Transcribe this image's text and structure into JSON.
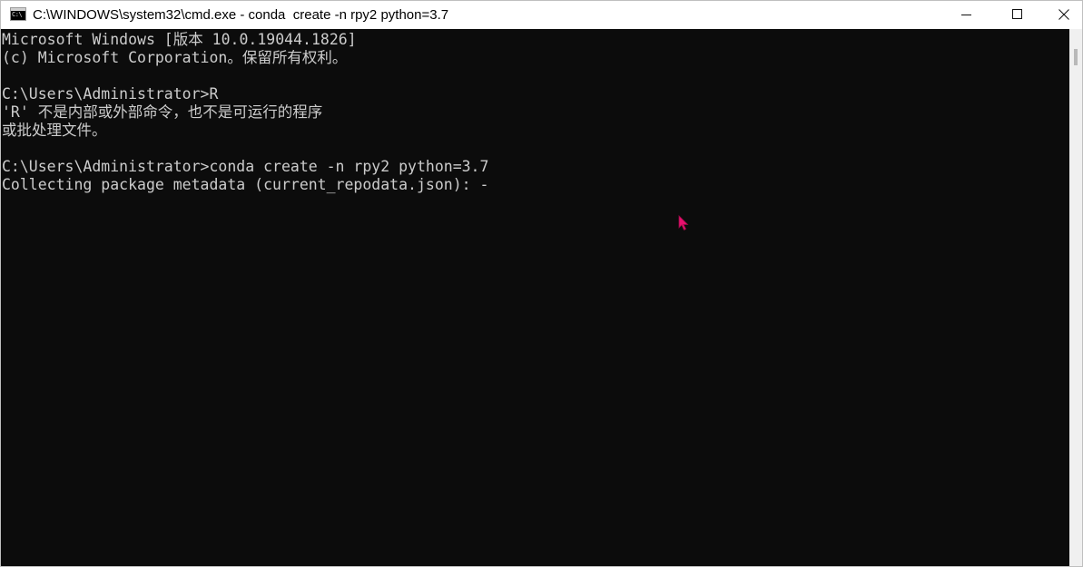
{
  "window": {
    "title": "C:\\WINDOWS\\system32\\cmd.exe - conda  create -n rpy2 python=3.7",
    "app_icon_text": "C:\\"
  },
  "console": {
    "lines": [
      "Microsoft Windows [版本 10.0.19044.1826]",
      "(c) Microsoft Corporation。保留所有权利。",
      "",
      "C:\\Users\\Administrator>R",
      "'R' 不是内部或外部命令，也不是可运行的程序",
      "或批处理文件。",
      "",
      "C:\\Users\\Administrator>conda create -n rpy2 python=3.7",
      "Collecting package metadata (current_repodata.json): -"
    ]
  },
  "colors": {
    "console_background": "#0c0c0c",
    "console_text": "#cccccc",
    "cursor_accent": "#e8106e"
  },
  "icons": {
    "app": "cmd-icon",
    "minimize": "minimize-icon",
    "maximize": "maximize-icon",
    "close": "close-icon",
    "pointer": "mouse-pointer-icon"
  }
}
